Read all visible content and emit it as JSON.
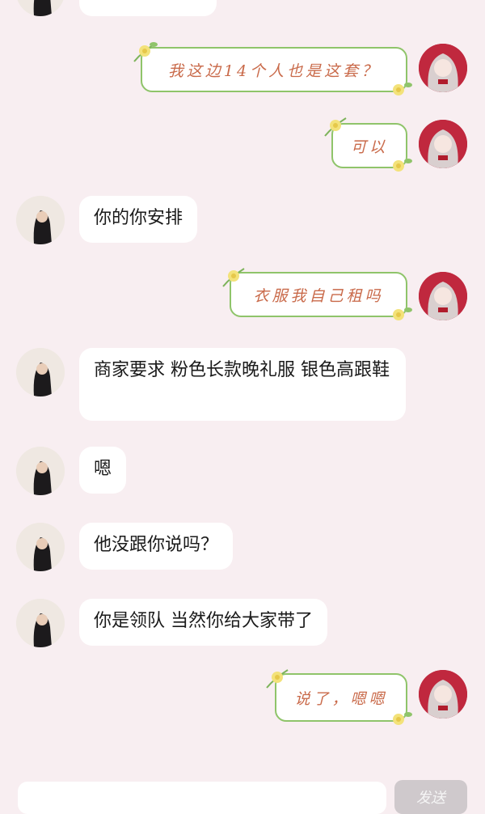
{
  "colors": {
    "background": "#f8eef1",
    "bubble_left": "#ffffff",
    "bubble_right_border": "#8fc46a",
    "bubble_right_text": "#c96a4a",
    "avatar_right_bg": "#c0283e",
    "send_button": "#cfc9cc"
  },
  "messages": [
    {
      "side": "right",
      "text": "我这边14个人也是这套？"
    },
    {
      "side": "right",
      "text": "可以"
    },
    {
      "side": "left",
      "text": "你的你安排"
    },
    {
      "side": "right",
      "text": "衣服我自己租吗"
    },
    {
      "side": "left",
      "text": "商家要求 粉色长款晚礼服 银色高跟鞋"
    },
    {
      "side": "left",
      "text": "嗯"
    },
    {
      "side": "left",
      "text": "他没跟你说吗？"
    },
    {
      "side": "left",
      "text": "你是领队 当然你给大家带了"
    },
    {
      "side": "right",
      "text": "说了，嗯嗯"
    }
  ],
  "input": {
    "placeholder": ""
  },
  "send_label": "发送",
  "icons": {
    "left_avatar": "girl-photo-avatar-icon",
    "right_avatar": "anime-girl-avatar-icon",
    "bubble_decoration": "flower-vine-icon"
  }
}
